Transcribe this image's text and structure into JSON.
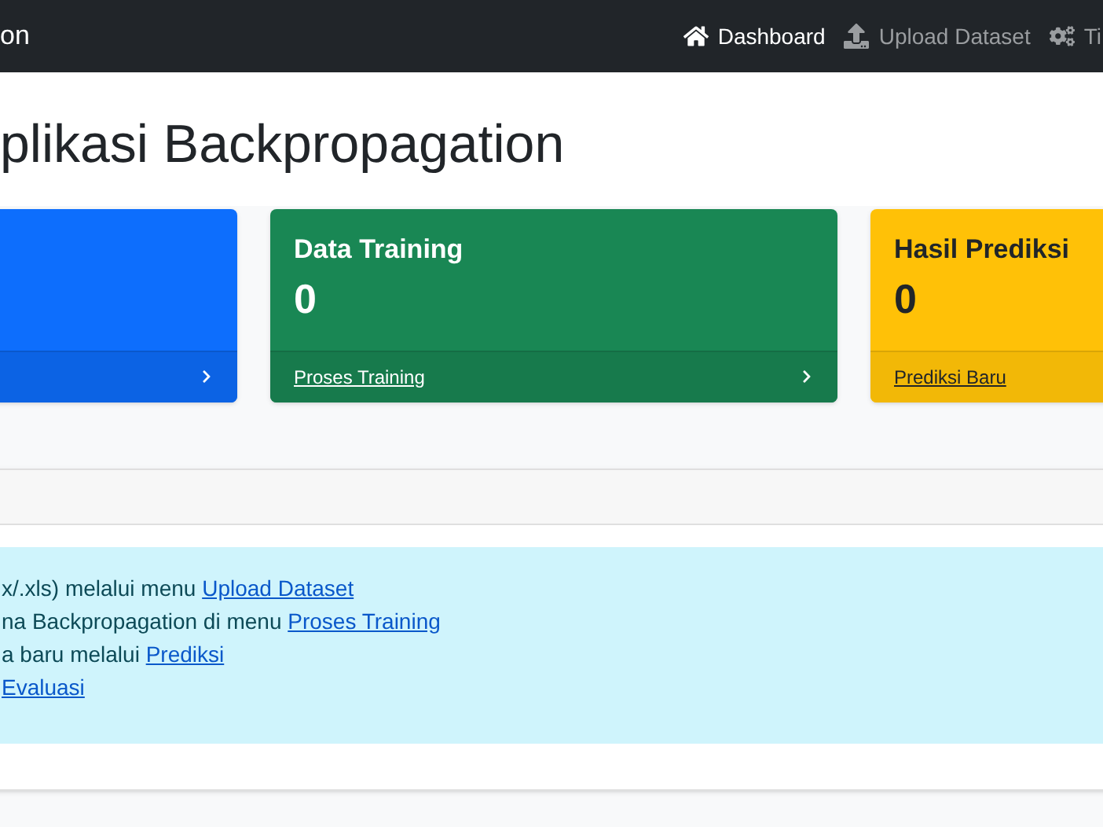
{
  "navbar": {
    "brand": "on",
    "items": [
      {
        "kind": "home",
        "label": "Dashboard",
        "selected": true
      },
      {
        "kind": "upload",
        "label": "Upload Dataset",
        "selected": false
      },
      {
        "kind": "cogs",
        "label": "Ti",
        "selected": false
      }
    ]
  },
  "title": "plikasi Backpropagation",
  "cards": [
    {
      "kind": "primary",
      "arrow": true
    },
    {
      "kind": "success",
      "title": "Data Training",
      "value": "0",
      "link": "Proses Training",
      "arrow": true
    },
    {
      "kind": "warning",
      "title": "Hasil Prediksi",
      "value": "0",
      "link": "Prediksi Baru"
    }
  ],
  "instructions": [
    {
      "text": "x/.xls) melalui menu ",
      "link": "Upload Dataset"
    },
    {
      "text": "na Backpropagation di menu ",
      "link": "Proses Training"
    },
    {
      "text": "a baru melalui ",
      "link": "Prediksi"
    },
    {
      "link": "Evaluasi"
    }
  ]
}
